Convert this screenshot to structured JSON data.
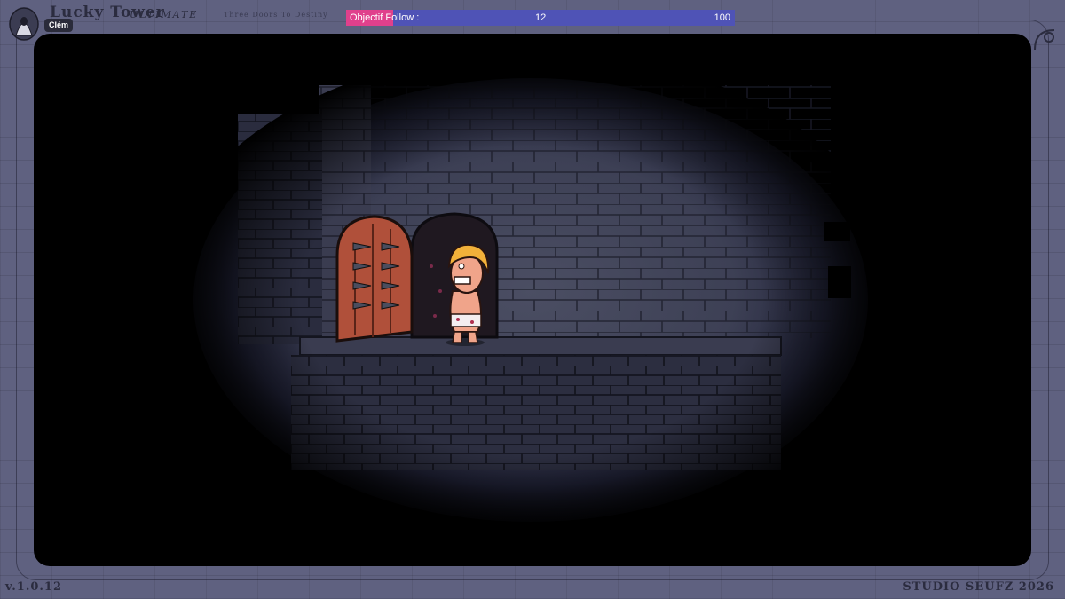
{
  "header": {
    "player_name": "Clém",
    "title": "Lucky Tower",
    "subtitle": "ULTIMATE",
    "tagline": "Three Doors To Destiny",
    "portrait_icon": "hooded-figure-icon"
  },
  "objective": {
    "label": "Objectif Follow :",
    "current": "12",
    "max": "100",
    "progress_fraction": 0.12,
    "fill_color": "#e0408c",
    "bar_color": "#4f53b6"
  },
  "scene": {
    "description_icons": [
      "spiked-door-icon",
      "dark-door-icon",
      "hero-character-icon",
      "brick-wall-icon"
    ]
  },
  "footer": {
    "version": "v.1.0.12",
    "studio": "STUDIO SEUFZ 2026"
  }
}
